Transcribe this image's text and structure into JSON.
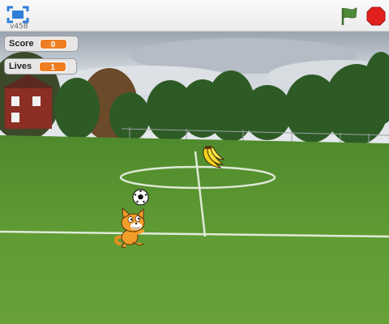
{
  "player": {
    "version": "v458",
    "fullscreen_icon": "fullscreen-icon",
    "green_flag_icon": "green-flag-icon",
    "stop_icon": "stop-sign-icon"
  },
  "monitors": {
    "score": {
      "label": "Score",
      "value": "0"
    },
    "lives": {
      "label": "Lives",
      "value": "1"
    }
  },
  "stage": {
    "backdrop": "soccer-field",
    "sprites": [
      "banana-sprite",
      "soccer-ball-sprite",
      "cat-sprite"
    ]
  },
  "colors": {
    "monitor_value": "#ef7e23",
    "flag": "#4f8a3b",
    "stop": "#e0201e",
    "fullscreen": "#2f7fd8"
  }
}
